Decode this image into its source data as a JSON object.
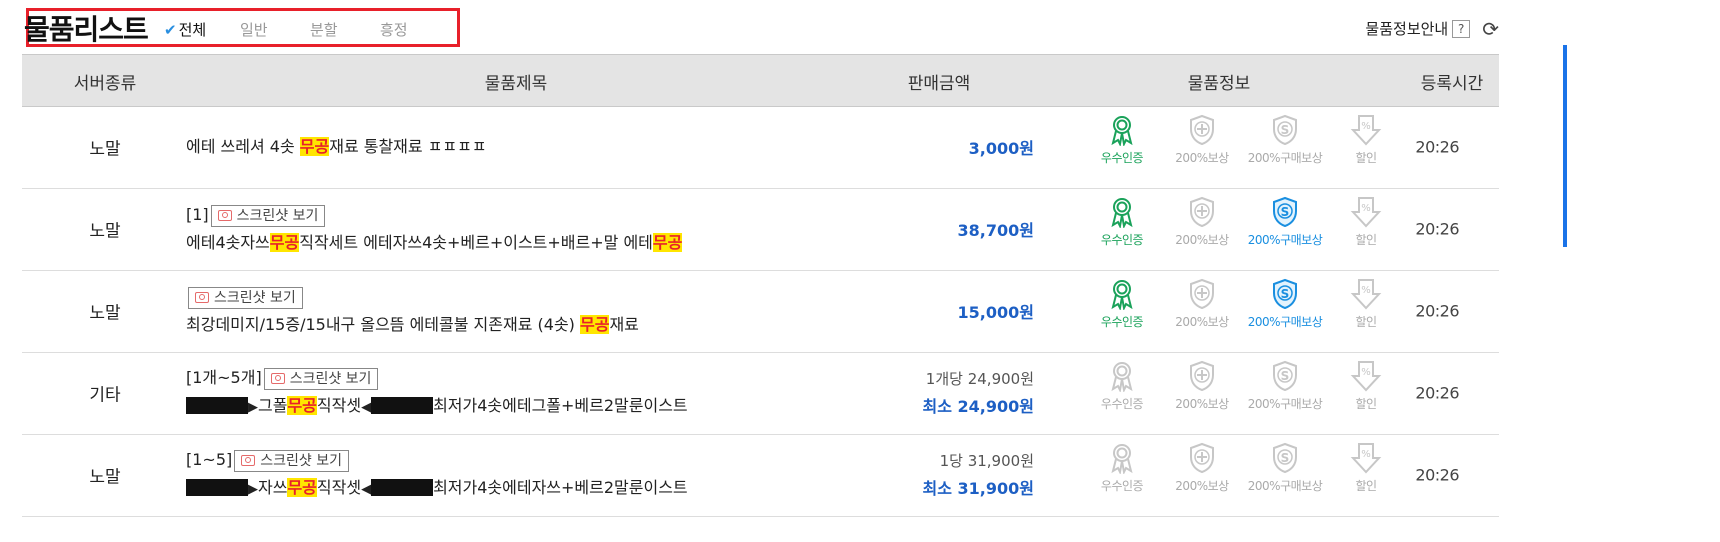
{
  "header": {
    "title": "물품리스트",
    "filters": [
      "전체",
      "일반",
      "분할",
      "흥정"
    ],
    "info_label": "물품정보안내",
    "help_glyph": "?",
    "refresh_icon": "refresh-icon"
  },
  "columns": [
    "서버종류",
    "물품제목",
    "판매금액",
    "물품정보",
    "등록시간"
  ],
  "badge_labels": [
    "우수인증",
    "200%보상",
    "200%구매보상",
    "할인"
  ],
  "screenshot_label": "스크린샷 보기",
  "rows": [
    {
      "server": "노말",
      "prefix": "",
      "show_shot": false,
      "title_pre": "에테 쓰레셔 4솟 ",
      "title_hl": "무공",
      "title_post": "재료 통찰재료 ㅍㅍㅍㅍ",
      "title_hl2": "",
      "price": "3,000원",
      "time": "20:26"
    },
    {
      "server": "노말",
      "prefix": "[1]",
      "show_shot": true,
      "title_pre": "에테4솟자쓰",
      "title_hl": "무공",
      "title_post": "직작세트 에테자쓰4솟+베르+이스트+배르+말 에테",
      "title_hl2": "무공",
      "price": "38,700원",
      "time": "20:26"
    },
    {
      "server": "노말",
      "prefix": "",
      "show_shot": true,
      "title_pre": "최강데미지/15증/15내구 올으뜸 에테콜불 지존재료 (4솟) ",
      "title_hl": "무공",
      "title_post": "재료",
      "title_hl2": "",
      "price": "15,000원",
      "time": "20:26"
    },
    {
      "server": "기타",
      "prefix": "[1개~5개]",
      "show_shot": true,
      "title_a": "그폴",
      "title_hl": "무공",
      "title_b": "직작셋",
      "title_c": "최저가4솟에테그폴+베르2말룬이스트",
      "unit_price": "1개당 24,900원",
      "min_price": "최소 24,900원",
      "time": "20:26"
    },
    {
      "server": "노말",
      "prefix": "[1~5]",
      "show_shot": true,
      "title_a": "자쓰",
      "title_hl": "무공",
      "title_b": "직작셋",
      "title_c": "최저가4솟에테자쓰+베르2말룬이스트",
      "unit_price": "1당 31,900원",
      "min_price": "최소 31,900원",
      "time": "20:26"
    }
  ],
  "row_badge_states": [
    [
      "active",
      "inactive",
      "inactive",
      "inactive"
    ],
    [
      "active",
      "inactive",
      "active",
      "inactive"
    ],
    [
      "active",
      "inactive",
      "active",
      "inactive"
    ],
    [
      "inactive",
      "inactive",
      "inactive",
      "inactive"
    ],
    [
      "inactive",
      "inactive",
      "inactive",
      "inactive"
    ]
  ],
  "colors": {
    "accent_blue": "#1d5fc4",
    "cert_green": "#1aa25a",
    "guarantee_blue": "#1a8fe0",
    "highlight": "#ffe600",
    "highlight_text": "#e8202a"
  }
}
